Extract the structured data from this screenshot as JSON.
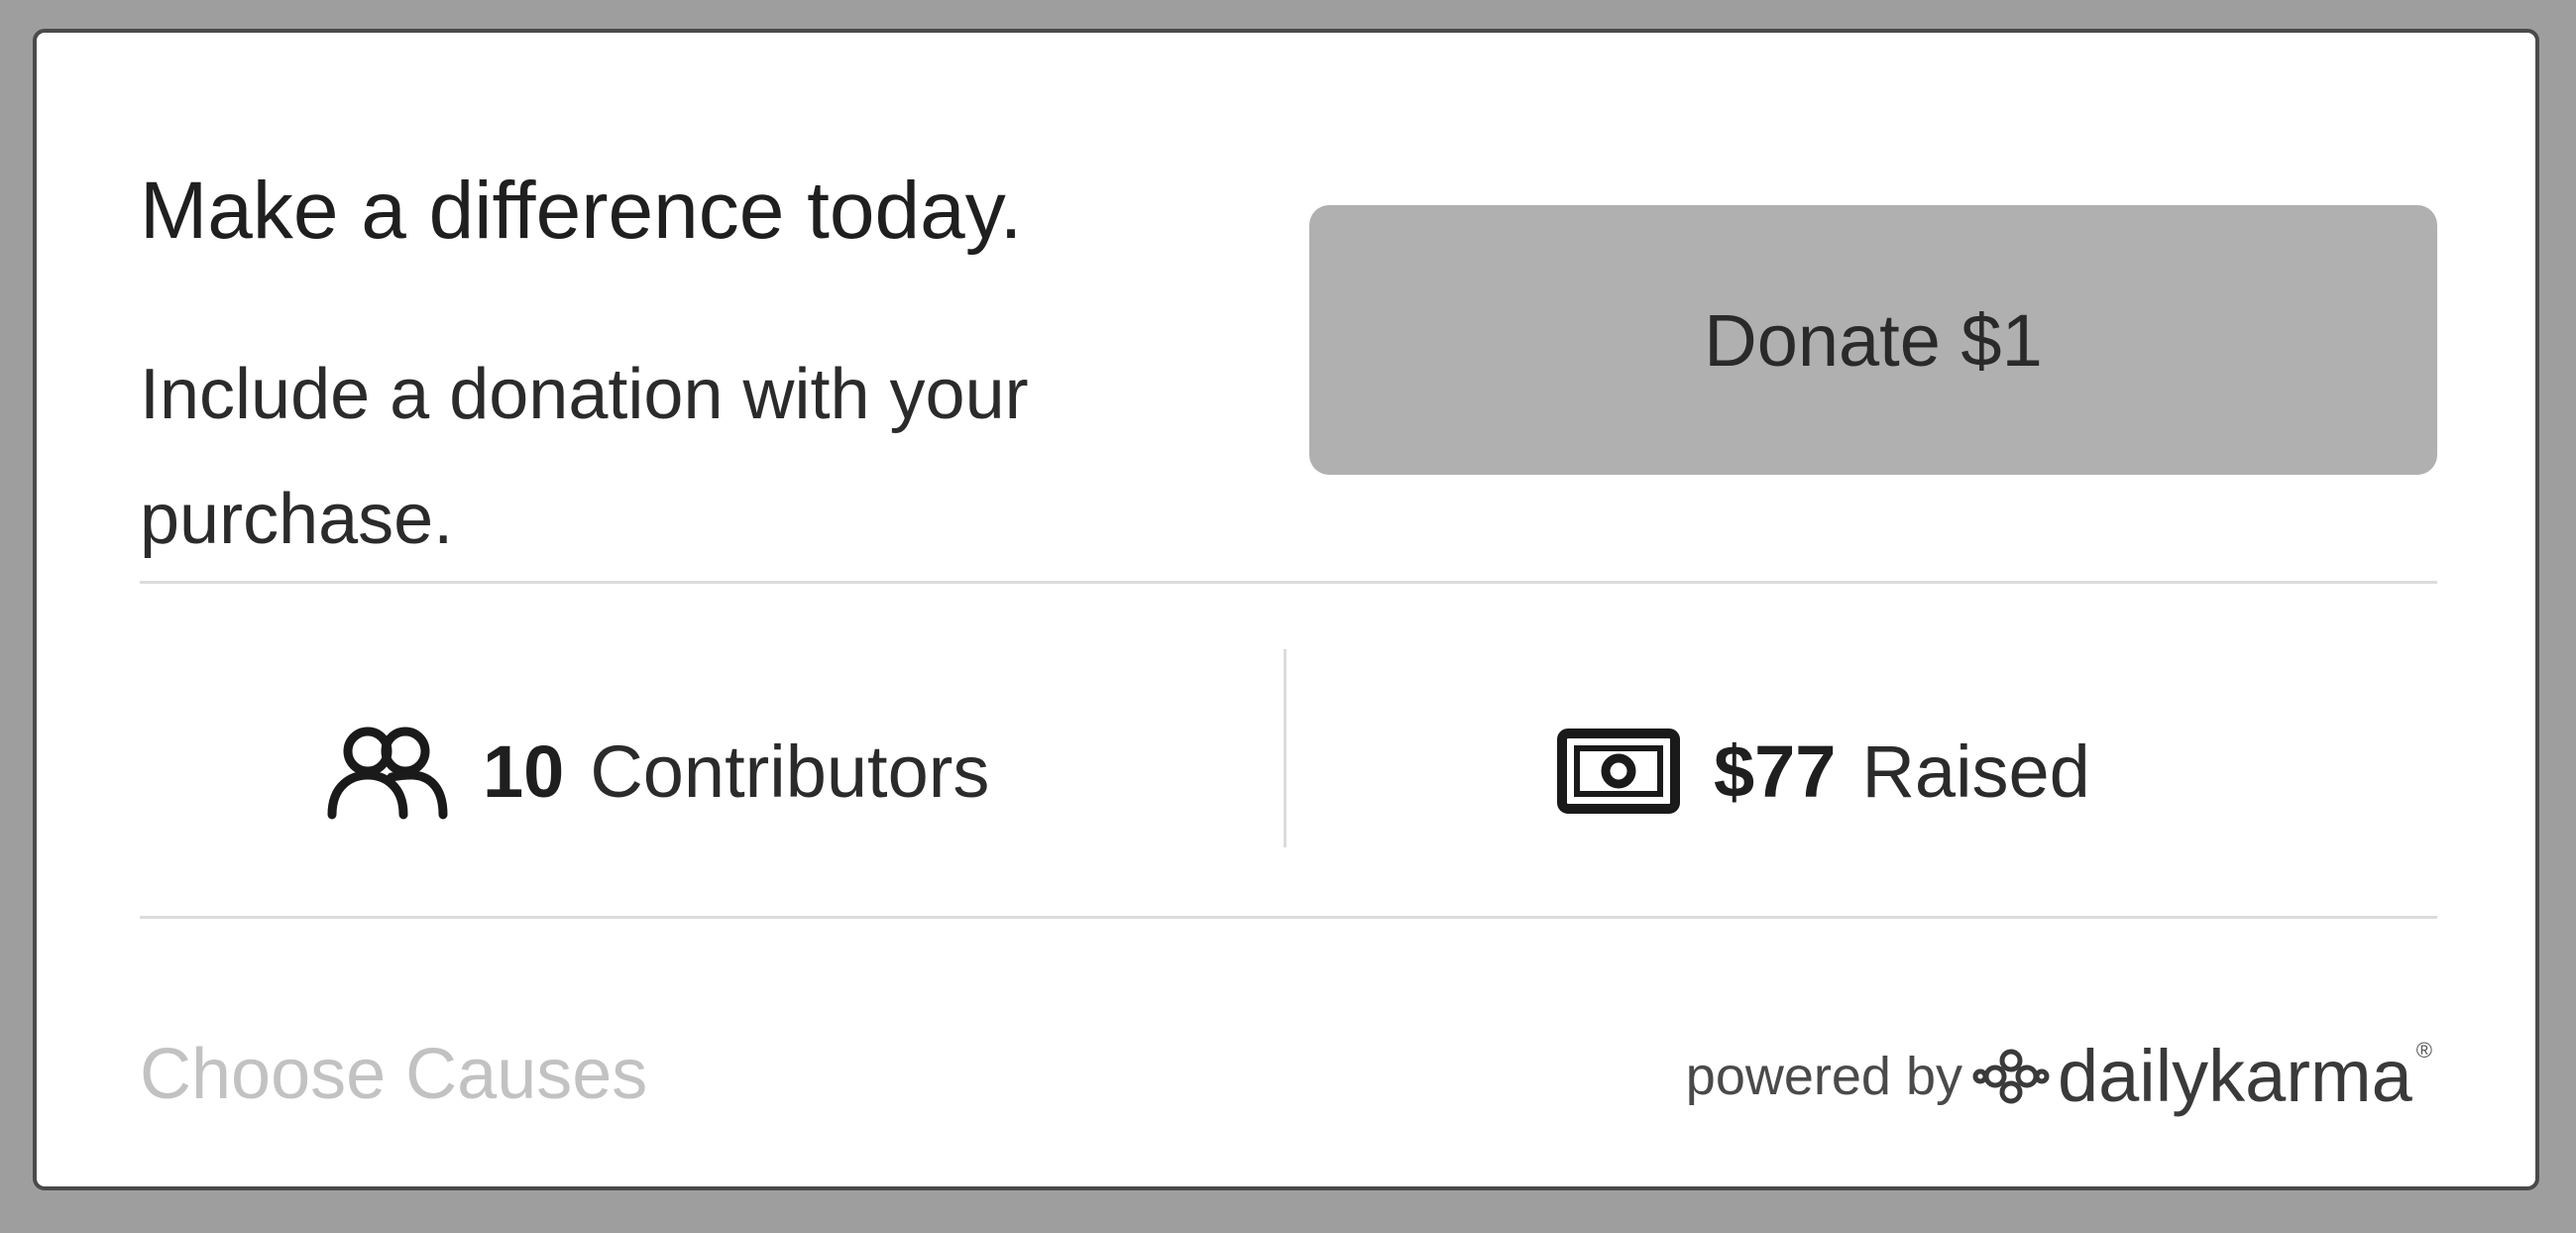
{
  "widget": {
    "headline": "Make a difference today.",
    "subtext": "Include a donation with your purchase.",
    "donate_button_label": "Donate $1"
  },
  "stats": {
    "contributors": {
      "icon": "users-icon",
      "count": "10",
      "label": "Contributors"
    },
    "raised": {
      "icon": "cash-icon",
      "amount": "$77",
      "label": "Raised"
    }
  },
  "footer": {
    "choose_causes_label": "Choose Causes",
    "powered_by_label": "powered by",
    "brand_logo_icon": "dailykarma-knot-logo-icon",
    "brand_name": "dailykarma",
    "brand_mark": "®"
  },
  "colors": {
    "background": "#9e9e9e",
    "card": "#ffffff",
    "donate_button": "#b0b0b0",
    "muted_link": "#c2c2c2"
  }
}
